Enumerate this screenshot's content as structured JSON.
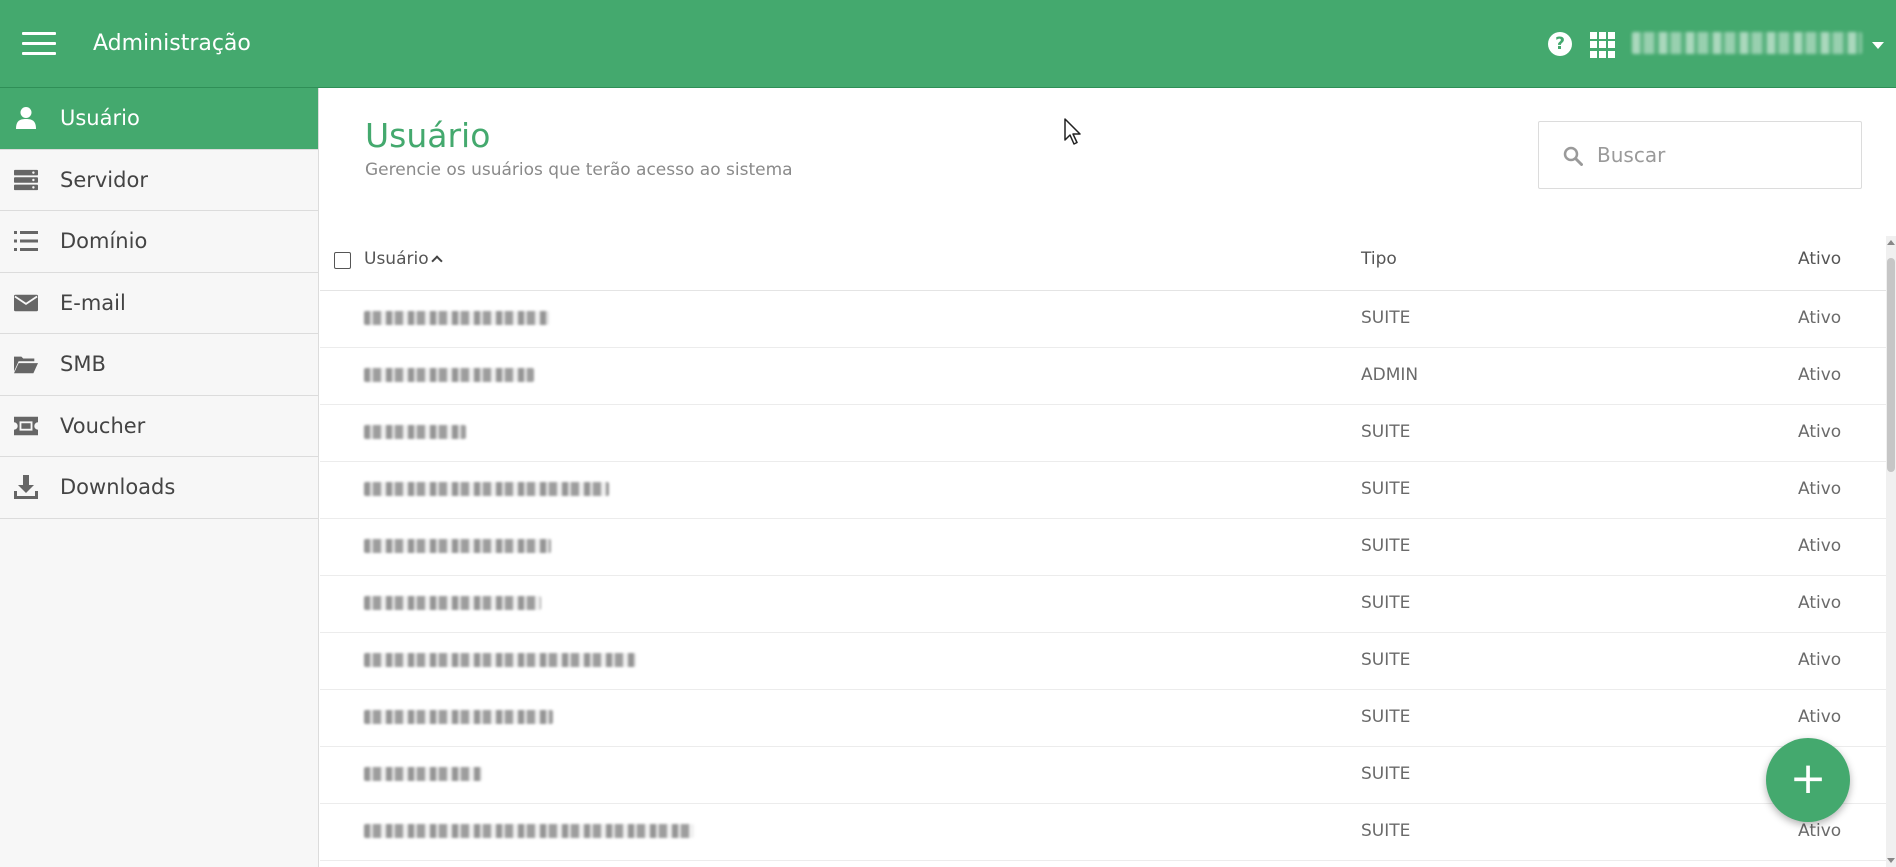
{
  "header": {
    "title": "Administração",
    "menu_icon": "hamburger-menu-icon",
    "help_icon": "question-circle-icon",
    "apps_icon": "apps-grid-icon"
  },
  "sidebar": {
    "items": [
      {
        "label": "Usuário",
        "icon": "user-icon",
        "active": true
      },
      {
        "label": "Servidor",
        "icon": "server-icon",
        "active": false
      },
      {
        "label": "Domínio",
        "icon": "list-icon",
        "active": false
      },
      {
        "label": "E-mail",
        "icon": "envelope-icon",
        "active": false
      },
      {
        "label": "SMB",
        "icon": "folder-open-icon",
        "active": false
      },
      {
        "label": "Voucher",
        "icon": "ticket-icon",
        "active": false
      },
      {
        "label": "Downloads",
        "icon": "download-icon",
        "active": false
      }
    ]
  },
  "page": {
    "title": "Usuário",
    "subtitle": "Gerencie os usuários que terão acesso ao sistema"
  },
  "search": {
    "placeholder": "Buscar"
  },
  "table": {
    "headers": {
      "user": "Usuário",
      "tipo": "Tipo",
      "ativo": "Ativo"
    },
    "rows": [
      {
        "tipo": "SUITE",
        "status": "Ativo"
      },
      {
        "tipo": "ADMIN",
        "status": "Ativo"
      },
      {
        "tipo": "SUITE",
        "status": "Ativo"
      },
      {
        "tipo": "SUITE",
        "status": "Ativo"
      },
      {
        "tipo": "SUITE",
        "status": "Ativo"
      },
      {
        "tipo": "SUITE",
        "status": "Ativo"
      },
      {
        "tipo": "SUITE",
        "status": "Ativo"
      },
      {
        "tipo": "SUITE",
        "status": "Ativo"
      },
      {
        "tipo": "SUITE",
        "status": ""
      },
      {
        "tipo": "SUITE",
        "status": "Ativo"
      }
    ]
  },
  "fab": {
    "label": "+"
  },
  "colors": {
    "brand": "#44a96e",
    "sidebar_bg": "#f7f7f7"
  }
}
